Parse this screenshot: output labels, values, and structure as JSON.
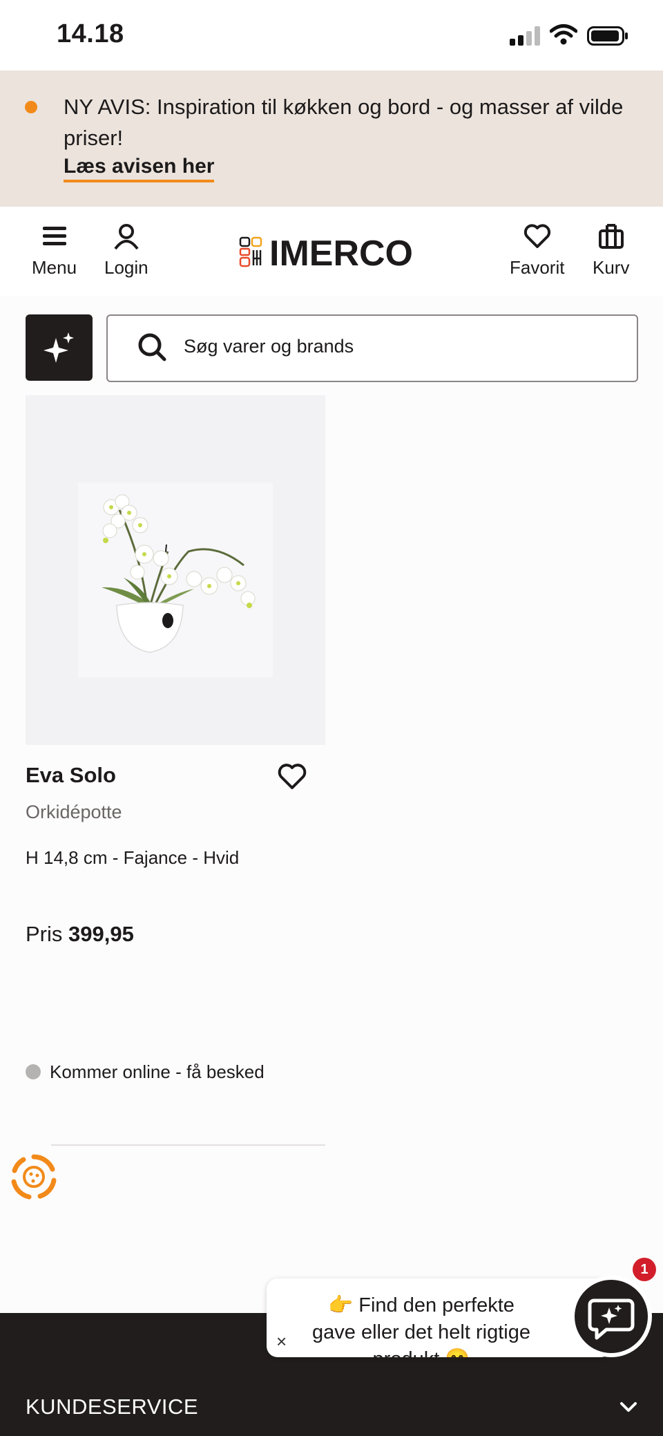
{
  "status_bar": {
    "time": "14.18"
  },
  "banner": {
    "text": "NY AVIS: Inspiration til køkken og bord - og masser af vilde priser!",
    "link": "Læs avisen her"
  },
  "header": {
    "menu_label": "Menu",
    "login_label": "Login",
    "logo_text": "IMERCO",
    "favorit_label": "Favorit",
    "kurv_label": "Kurv"
  },
  "search": {
    "placeholder": "Søg varer og brands"
  },
  "product": {
    "brand": "Eva Solo",
    "name": "Orkidépotte",
    "specs": "H 14,8 cm - Fajance - Hvid",
    "price_label": "Pris",
    "price_value": "399,95",
    "stock_status": "Kommer online - få besked"
  },
  "chat": {
    "popup_text": "👉 Find den perfekte gave eller det helt rigtige produkt 😊",
    "close": "×",
    "badge": "1"
  },
  "footer": {
    "kundeservice": "KUNDESERVICE"
  },
  "colors": {
    "accent": "#f28a1a",
    "banner_bg": "#ebe3dc",
    "dark": "#221d1d",
    "badge": "#d21e2b"
  }
}
